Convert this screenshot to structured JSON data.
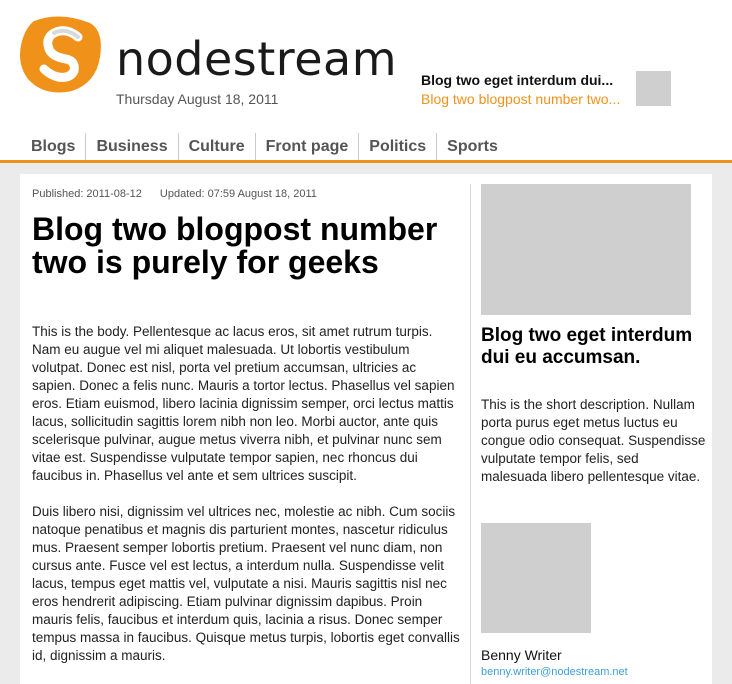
{
  "brand": {
    "name": "nodestream",
    "accent_color": "#f0921a",
    "logo_icon": "nodestream-logo-icon"
  },
  "header": {
    "date": "Thursday August 18, 2011",
    "teaser": {
      "title": "Blog two eget interdum dui...",
      "link": "Blog two blogpost number two..."
    }
  },
  "nav": {
    "items": [
      "Blogs",
      "Business",
      "Culture",
      "Front page",
      "Politics",
      "Sports"
    ]
  },
  "article": {
    "published": "Published: 2011-08-12",
    "updated": "Updated: 07:59 August 18, 2011",
    "title": "Blog two blogpost number two is purely for geeks",
    "paragraphs": [
      "This is the body. Pellentesque ac lacus eros, sit amet rutrum turpis. Nam eu augue vel mi aliquet malesuada. Ut lobortis vestibulum volutpat. Donec est nisl, porta vel pretium accumsan, ultricies ac sapien. Donec a felis nunc. Mauris a tortor lectus. Phasellus vel sapien eros. Etiam euismod, libero lacinia dignissim semper, orci lectus mattis lacus, sollicitudin sagittis lorem nibh non leo. Morbi auctor, ante quis scelerisque pulvinar, augue metus viverra nibh, et pulvinar nunc sem vitae est. Suspendisse vulputate tempor sapien, nec rhoncus dui faucibus in. Phasellus vel ante et sem ultrices suscipit.",
      "Duis libero nisi, dignissim vel ultrices nec, molestie ac nibh. Cum sociis natoque penatibus et magnis dis parturient montes, nascetur ridiculus mus. Praesent semper lobortis pretium. Praesent vel nunc diam, non cursus ante. Fusce vel est lectus, a interdum nulla. Suspendisse velit lacus, tempus eget mattis vel, vulputate a nisi. Mauris sagittis nisl nec eros hendrerit adipiscing. Etiam pulvinar dignissim dapibus. Proin mauris felis, faucibus et interdum quis, lacinia a risus. Donec semper tempus massa in faucibus. Quisque metus turpis, lobortis eget convallis id, dignissim a mauris."
    ]
  },
  "sidebar": {
    "title": "Blog two eget interdum dui eu accumsan.",
    "description": "This is the short description. Nullam porta purus eget metus luctus eu congue odio consequat. Suspendisse vulputate tempor felis, sed malesuada libero pellentesque vitae.",
    "author": {
      "name": "Benny Writer",
      "email": "benny.writer@nodestream.net"
    }
  }
}
